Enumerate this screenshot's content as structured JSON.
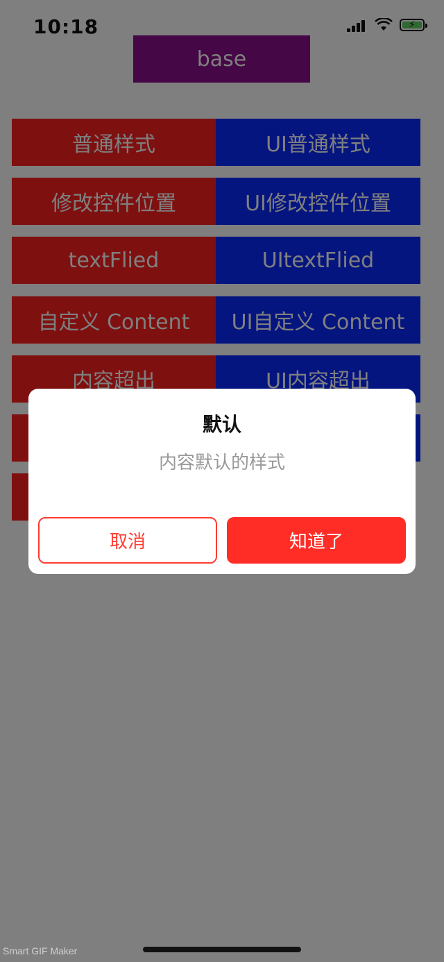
{
  "status_bar": {
    "time": "10:18"
  },
  "header": {
    "base_label": "base"
  },
  "rows": [
    {
      "left": "普通样式",
      "right": "UI普通样式"
    },
    {
      "left": "修改控件位置",
      "right": "UI修改控件位置"
    },
    {
      "left": "textFlied",
      "right": "UItextFlied"
    },
    {
      "left": "自定义 Content",
      "right": "UI自定义 Content"
    },
    {
      "left": "内容超出",
      "right": "UI内容超出"
    },
    {
      "left": "",
      "right": ""
    },
    {
      "left": "",
      "right": ""
    }
  ],
  "dialog": {
    "title": "默认",
    "message": "内容默认的样式",
    "cancel_label": "取消",
    "confirm_label": "知道了"
  },
  "watermark": "Smart GIF Maker",
  "colors": {
    "base_button": "#8a0f8a",
    "left_button": "#ff2020",
    "right_button": "#0a2bff",
    "dialog_accent": "#ff2d26"
  }
}
